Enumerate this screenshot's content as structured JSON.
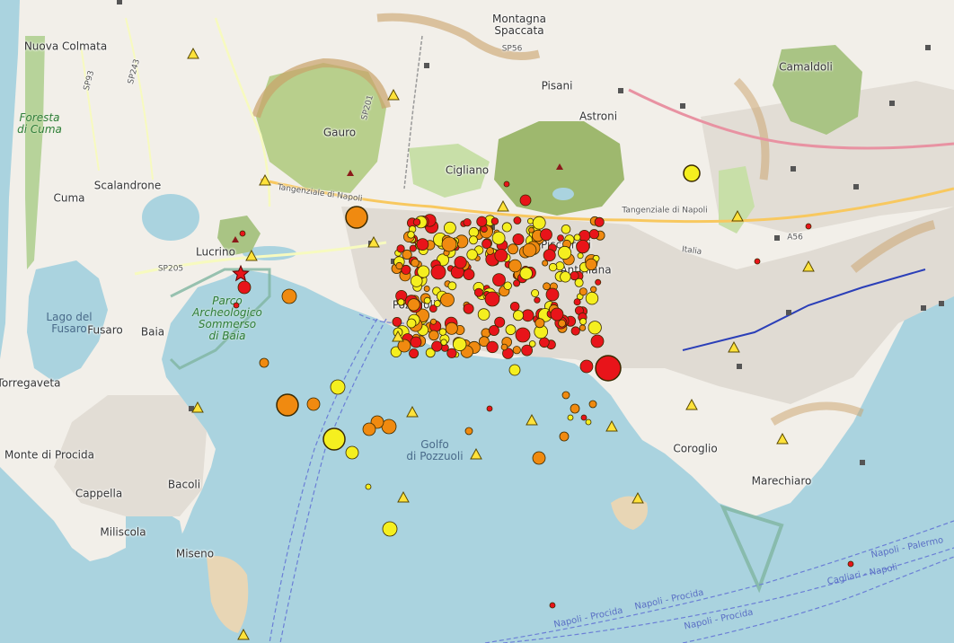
{
  "colors": {
    "sea": "#aad3df",
    "land": "#f2efe9",
    "urban": "#e0dbd3",
    "park": "#c8dfa8",
    "crater": "#9eb86e",
    "cliff": "#c9a26a",
    "event_yellow": "#f5ef1f",
    "event_orange": "#f08a10",
    "event_red": "#e8141a",
    "station_triangle": "#ffe23a",
    "ferry_line": "#6b7fd6"
  },
  "place_labels": [
    {
      "id": "nuova-colmata",
      "text": "Nuova Colmata"
    },
    {
      "id": "montagna-spaccata",
      "text": "Montagna\nSpaccata"
    },
    {
      "id": "camaldoli",
      "text": "Camaldoli"
    },
    {
      "id": "pisani",
      "text": "Pisani"
    },
    {
      "id": "astroni",
      "text": "Astroni"
    },
    {
      "id": "gauro",
      "text": "Gauro"
    },
    {
      "id": "cigliano",
      "text": "Cigliano"
    },
    {
      "id": "scalandrone",
      "text": "Scalandrone"
    },
    {
      "id": "cuma",
      "text": "Cuma"
    },
    {
      "id": "lucrino",
      "text": "Lucrino"
    },
    {
      "id": "pozzuoli",
      "text": "Pozzuoli"
    },
    {
      "id": "pisciarelli",
      "text": "Pisciarelli"
    },
    {
      "id": "antiniana",
      "text": "Antiniana"
    },
    {
      "id": "fusaro",
      "text": "Fusaro"
    },
    {
      "id": "baia",
      "text": "Baia"
    },
    {
      "id": "torregaveta",
      "text": "Torregaveta"
    },
    {
      "id": "monte-di-procida",
      "text": "Monte di Procida"
    },
    {
      "id": "bacoli",
      "text": "Bacoli"
    },
    {
      "id": "cappella",
      "text": "Cappella"
    },
    {
      "id": "miliscola",
      "text": "Miliscola"
    },
    {
      "id": "miseno",
      "text": "Miseno"
    },
    {
      "id": "coroglio",
      "text": "Coroglio"
    },
    {
      "id": "marechiaro",
      "text": "Marechiaro"
    }
  ],
  "water_labels": [
    {
      "id": "lago-del-fusaro",
      "text": "Lago del\nFusaro"
    },
    {
      "id": "golfo-di-pozzuoli",
      "text": "Golfo\ndi Pozzuoli"
    }
  ],
  "park_labels": [
    {
      "id": "foresta-di-cuma",
      "text": "Foresta\ndi Cuma"
    },
    {
      "id": "parco-sommerso",
      "text": "Parco\nArcheologico\nSommerso\ndi Baia"
    }
  ],
  "road_labels": [
    {
      "id": "tangenziale-1",
      "text": "Tangenziale di Napoli"
    },
    {
      "id": "tangenziale-2",
      "text": "Tangenziale di Napoli"
    },
    {
      "id": "sp205",
      "text": "SP205"
    },
    {
      "id": "sp201",
      "text": "SP201"
    },
    {
      "id": "sp56",
      "text": "SP56"
    },
    {
      "id": "a56",
      "text": "A56"
    },
    {
      "id": "sp93",
      "text": "SP93"
    },
    {
      "id": "sp243",
      "text": "SP243"
    },
    {
      "id": "italia",
      "text": "Italia"
    }
  ],
  "ferry_labels": [
    {
      "id": "ferry-1",
      "text": "Napoli - Procida"
    },
    {
      "id": "ferry-2",
      "text": "Napoli - Procida"
    },
    {
      "id": "ferry-3",
      "text": "Napoli - Procida"
    },
    {
      "id": "ferry-4",
      "text": "Cagliari - Napoli"
    },
    {
      "id": "ferry-5",
      "text": "Napoli - Palermo"
    }
  ],
  "legend_symbols": {
    "epicenter_marker": "red star",
    "seismic_station": "yellow triangle",
    "event_colors": [
      "yellow",
      "orange",
      "red"
    ]
  }
}
